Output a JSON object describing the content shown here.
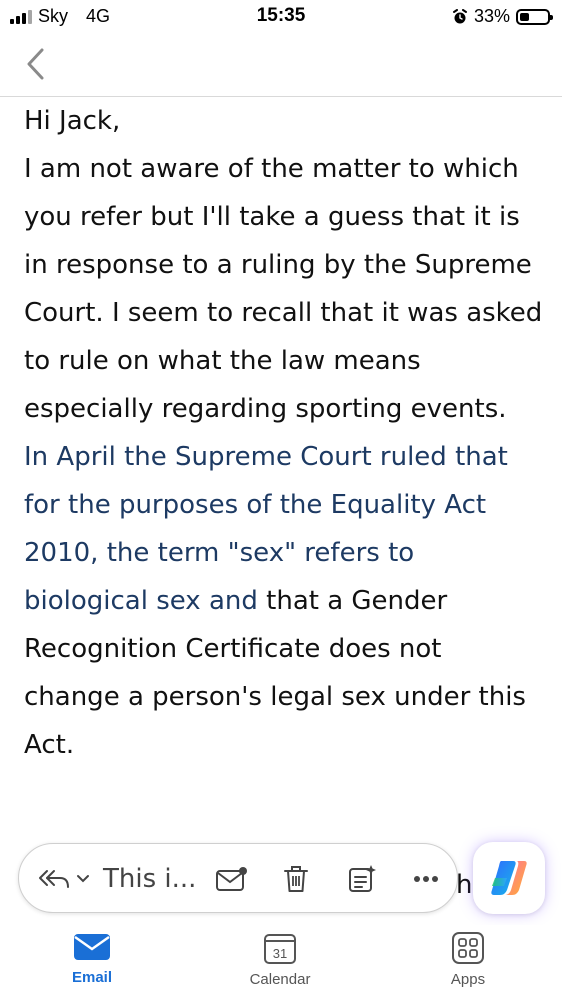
{
  "status_bar": {
    "carrier": "Sky",
    "network": "4G",
    "time": "15:35",
    "battery": "33%",
    "battery_level": 0.33
  },
  "email": {
    "greeting": "Hi Jack,",
    "paragraph1": "I am not aware of the matter to which you refer but I'll take a guess that it is in response to a ruling by the Supreme Court. I seem to recall that it was asked to rule on what the law means especially regarding sporting events.",
    "quoted": "In April the Supreme Court ruled that for the purposes of the Equality Act 2010, the term \"sex\" refers to biological sex and",
    "continuation": " that a Gender Recognition Certificate does not change a person's legal sex under this Act."
  },
  "toolbar": {
    "preview_text": "This i...",
    "partial_text_behind": "h"
  },
  "tabs": [
    {
      "label": "Email",
      "icon": "envelope-icon",
      "active": true
    },
    {
      "label": "Calendar",
      "icon": "calendar-icon",
      "day": "31",
      "active": false
    },
    {
      "label": "Apps",
      "icon": "apps-grid-icon",
      "active": false
    }
  ],
  "colors": {
    "accent": "#1a6fd6",
    "quoted_text": "#1d3a63",
    "text": "#111111"
  }
}
